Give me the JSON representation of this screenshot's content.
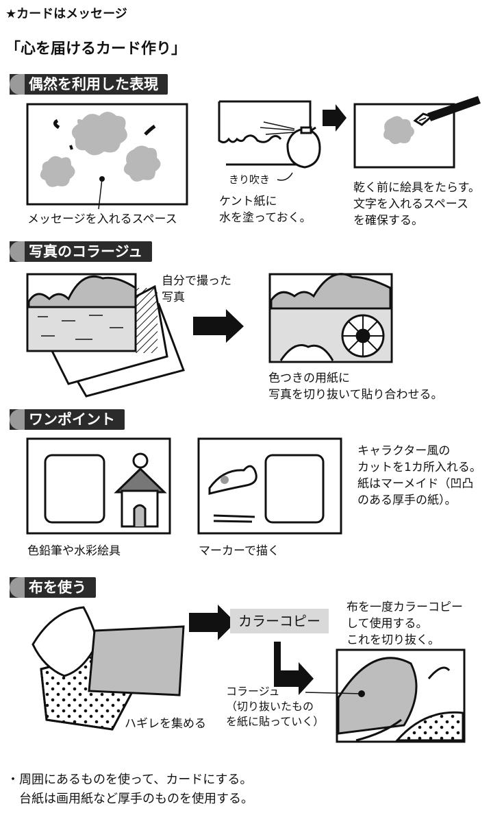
{
  "header": {
    "tag": "★カードはメッセージ"
  },
  "title": "「心を届けるカード作り」",
  "sections": [
    {
      "label": "偶然を利用した表現"
    },
    {
      "label": "写真のコラージュ"
    },
    {
      "label": "ワンポイント"
    },
    {
      "label": "布を使う"
    }
  ],
  "s1": {
    "message_space": "メッセージを入れるスペース",
    "sprayer": "きり吹き",
    "wet_paper": "ケント紙に\n水を塗っておく。",
    "drip_paint": "乾く前に絵具をたらす。\n文字を入れるスペース\nを確保する。"
  },
  "s2": {
    "own_photo": "自分で撮った\n写真",
    "cut_paste": "色つきの用紙に\n写真を切り抜いて貼り合わせる。"
  },
  "s3": {
    "pencil": "色鉛筆や水彩絵具",
    "marker": "マーカーで描く",
    "character": "キャラクター風の\nカットを1カ所入れる。\n紙はマーメイド（凹凸\nのある厚手の紙）。"
  },
  "s4": {
    "color_copy_box": "カラーコピー",
    "copy_note": "布を一度カラーコピー\nして使用する。\nこれを切り抜く。",
    "scraps": "ハギレを集める",
    "collage": "コラージュ\n（切り抜いたもの\nを紙に貼っていく）"
  },
  "footer": "・周囲にあるものを使って、カードにする。\n　台紙は画用紙など厚手のものを使用する。"
}
